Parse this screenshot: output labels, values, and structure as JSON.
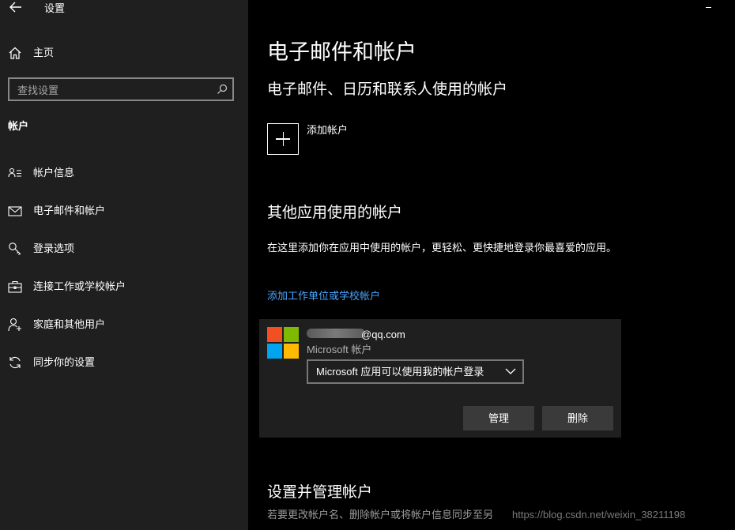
{
  "window": {
    "title": "设置",
    "back_icon": "back-arrow-icon",
    "minimize_icon": "minimize-icon"
  },
  "sidebar": {
    "home": {
      "label": "主页",
      "icon": "home-icon"
    },
    "search": {
      "placeholder": "查找设置",
      "icon": "search-icon"
    },
    "section": "帐户",
    "items": [
      {
        "label": "帐户信息",
        "icon": "account-info-icon"
      },
      {
        "label": "电子邮件和帐户",
        "icon": "mail-icon"
      },
      {
        "label": "登录选项",
        "icon": "key-icon"
      },
      {
        "label": "连接工作或学校帐户",
        "icon": "briefcase-icon"
      },
      {
        "label": "家庭和其他用户",
        "icon": "add-person-icon"
      },
      {
        "label": "同步你的设置",
        "icon": "sync-icon"
      }
    ]
  },
  "main": {
    "title": "电子邮件和帐户",
    "email_section": {
      "heading": "电子邮件、日历和联系人使用的帐户",
      "add_label": "添加帐户"
    },
    "other_section": {
      "heading": "其他应用使用的帐户",
      "description": "在这里添加你在应用中使用的帐户，更轻松、更快捷地登录你最喜爱的应用。",
      "link": "添加工作单位或学校帐户"
    },
    "account_card": {
      "email": "@qq.com",
      "type": "Microsoft 帐户",
      "dropdown_value": "Microsoft 应用可以使用我的帐户登录",
      "manage_label": "管理",
      "delete_label": "删除",
      "logo_colors": [
        "#f25022",
        "#7fba00",
        "#00a4ef",
        "#ffb900"
      ]
    },
    "manage_section": {
      "heading": "设置并管理帐户",
      "description": "若要更改帐户名、删除帐户或将帐户信息同步至另"
    },
    "watermark": "https://blog.csdn.net/weixin_38211198"
  },
  "colors": {
    "sidebar_bg": "#1f1f1f",
    "main_bg": "#000000",
    "link": "#4aa6ff",
    "button_bg": "#3a3a3a"
  }
}
